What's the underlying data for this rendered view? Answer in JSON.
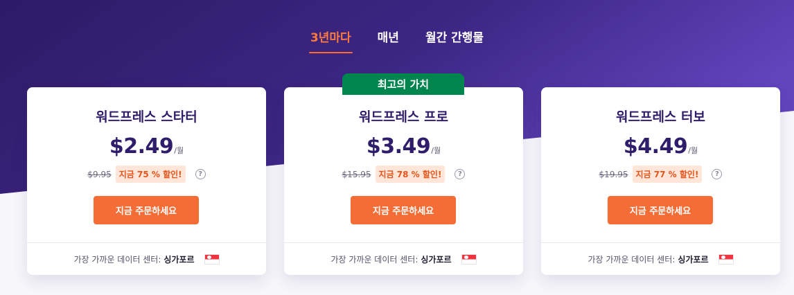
{
  "colors": {
    "hero_dark": "#2e1a66",
    "hero_light": "#6244bd",
    "accent_orange": "#f56d36",
    "best_value_green": "#00854f",
    "heading_navy": "#2f1c6a"
  },
  "tabs": [
    {
      "label": "3년마다",
      "active": true
    },
    {
      "label": "매년",
      "active": false
    },
    {
      "label": "월간 간행물",
      "active": false
    }
  ],
  "plans": [
    {
      "name": "워드프레스 스타터",
      "price": "$2.49",
      "per": "/월",
      "old_price": "$9.95",
      "discount": "지금 75 % 할인!",
      "help_icon": "question-circle-icon",
      "cta": "지금 주문하세요",
      "datacenter_label": "가장 가까운 데이터 센터:",
      "datacenter": "싱가포르",
      "flag_icon": "singapore-flag-icon"
    },
    {
      "ribbon": "최고의 가치",
      "name": "워드프레스 프로",
      "price": "$3.49",
      "per": "/월",
      "old_price": "$15.95",
      "discount": "지금 78 % 할인!",
      "help_icon": "question-circle-icon",
      "cta": "지금 주문하세요",
      "datacenter_label": "가장 가까운 데이터 센터:",
      "datacenter": "싱가포르",
      "flag_icon": "singapore-flag-icon"
    },
    {
      "name": "워드프레스 터보",
      "price": "$4.49",
      "per": "/월",
      "old_price": "$19.95",
      "discount": "지금 77 % 할인!",
      "help_icon": "question-circle-icon",
      "cta": "지금 주문하세요",
      "datacenter_label": "가장 가까운 데이터 센터:",
      "datacenter": "싱가포르",
      "flag_icon": "singapore-flag-icon"
    }
  ]
}
